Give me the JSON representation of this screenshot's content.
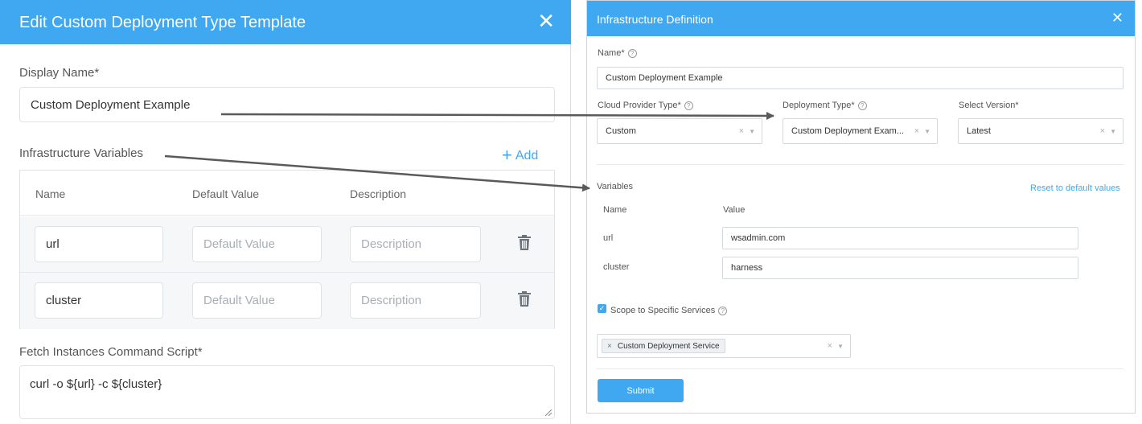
{
  "left_dialog": {
    "title": "Edit Custom Deployment Type Template",
    "close_glyph": "✕",
    "display_name_label": "Display Name*",
    "display_name_value": "Custom Deployment Example",
    "infra_vars_label": "Infrastructure Variables",
    "add_label": "Add",
    "columns": {
      "name": "Name",
      "default_value": "Default Value",
      "description": "Description"
    },
    "rows": [
      {
        "name": "url",
        "default_placeholder": "Default Value",
        "description_placeholder": "Description"
      },
      {
        "name": "cluster",
        "default_placeholder": "Default Value",
        "description_placeholder": "Description"
      }
    ],
    "script_label": "Fetch Instances Command Script*",
    "script_value": "curl -o ${url} -c ${cluster}"
  },
  "right_dialog": {
    "title": "Infrastructure Definition",
    "close_glyph": "✕",
    "name_label": "Name*",
    "name_value": "Custom Deployment Example",
    "cloud_provider_label": "Cloud Provider Type*",
    "cloud_provider_value": "Custom",
    "deployment_type_label": "Deployment Type*",
    "deployment_type_value": "Custom Deployment Exam...",
    "select_version_label": "Select Version*",
    "select_version_value": "Latest",
    "variables_label": "Variables",
    "reset_label": "Reset to default values",
    "var_columns": {
      "name": "Name",
      "value": "Value"
    },
    "variables": [
      {
        "name": "url",
        "value": "wsadmin.com"
      },
      {
        "name": "cluster",
        "value": "harness"
      }
    ],
    "scope_label": "Scope to Specific Services",
    "scope_checked": true,
    "service_tag": "Custom Deployment Service",
    "submit_label": "Submit"
  },
  "icons": {
    "help": "help-circle-icon",
    "trash": "trash-icon",
    "close": "close-icon",
    "plus": "plus-icon",
    "caret": "chevron-down-icon",
    "clear": "clear-x-icon"
  },
  "colors": {
    "header_blue": "#3fa8f0",
    "arrow_gray": "#5a5a5a",
    "link_blue": "#3fa8f0"
  }
}
